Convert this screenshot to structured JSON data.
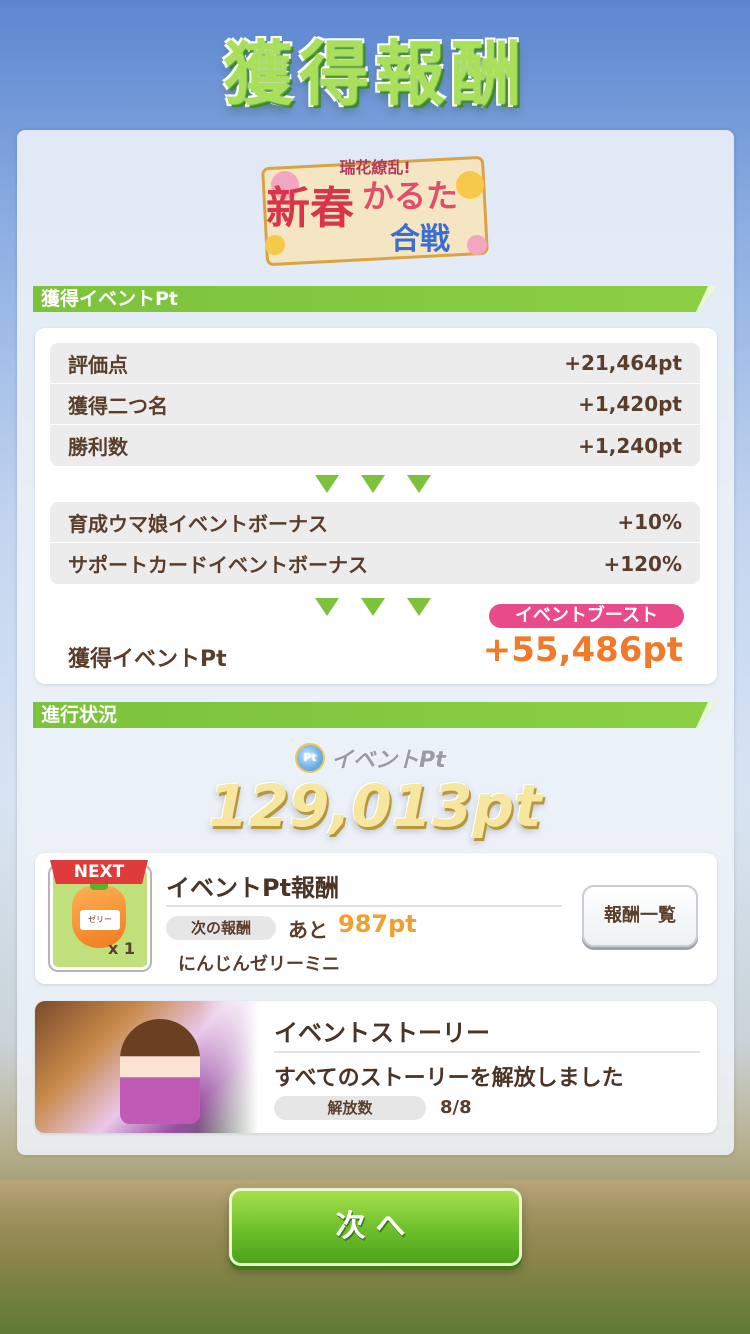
{
  "header": {
    "title": "獲得報酬"
  },
  "logo": {
    "small_text": "瑞花繚乱!",
    "title_line1": "新春",
    "title_line2": "かるた",
    "title_line3": "合戦"
  },
  "event_pt_section": {
    "label": "獲得イベントPt",
    "score_rows": [
      {
        "label": "評価点",
        "value": "+21,464pt"
      },
      {
        "label": "獲得二つ名",
        "value": "+1,420pt"
      },
      {
        "label": "勝利数",
        "value": "+1,240pt"
      }
    ],
    "bonus_rows": [
      {
        "label": "育成ウマ娘イベントボーナス",
        "value": "+10%"
      },
      {
        "label": "サポートカードイベントボーナス",
        "value": "+120%"
      }
    ],
    "boost_badge": "イベントブースト",
    "earned_label": "獲得イベントPt",
    "earned_value": "+55,486pt"
  },
  "progress_section": {
    "label": "進行状況",
    "pt_icon_text": "Pt",
    "pt_label": "イベントPt",
    "total": "129,013pt"
  },
  "reward_card": {
    "next_tag": "NEXT",
    "item_label": "ゼリー",
    "item_qty": "x 1",
    "title": "イベントPt報酬",
    "next_pill": "次の報酬",
    "remaining_prefix": "あと",
    "remaining_value": "987pt",
    "item_name": "にんじんゼリーミニ",
    "list_button": "報酬一覧"
  },
  "story_card": {
    "title": "イベントストーリー",
    "status": "すべてのストーリーを解放しました",
    "unlock_pill": "解放数",
    "unlock_value": "8/8"
  },
  "footer": {
    "next_button": "次へ"
  },
  "colors": {
    "accent_green": "#7cc23c",
    "earned_orange": "#f07a2a",
    "boost_pink": "#e84a8a",
    "remaining_orange": "#f0a030"
  }
}
